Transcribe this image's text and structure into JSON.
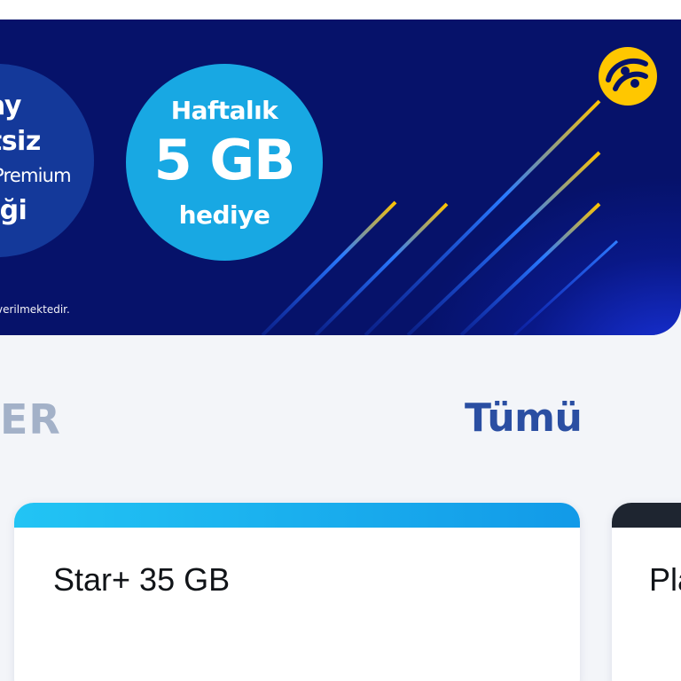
{
  "banner": {
    "promo_left": {
      "line1": "ay",
      "line2": "etsiz",
      "line3": "e Premium",
      "line4": "liği"
    },
    "offer": {
      "period": "Haftalık",
      "amount": "5 GB",
      "gift": "hediye"
    },
    "disclaimer": "verilmektedir.",
    "logo_icon": "turkcell-logo-icon",
    "colors": {
      "background": "#06126a",
      "offer_circle": "#18a8e3",
      "left_circle": "#14399a",
      "logo": "#ffc700"
    }
  },
  "section": {
    "title": "ER",
    "see_all": "Tümü"
  },
  "packages": [
    {
      "name": "Star+ 35 GB",
      "accent": "#1aaef0"
    },
    {
      "name": "Pla",
      "accent": "#1e2530"
    }
  ]
}
